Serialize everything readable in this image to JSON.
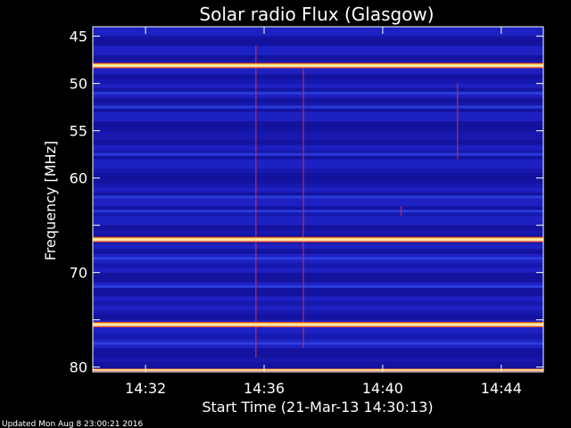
{
  "chart_data": {
    "type": "heatmap",
    "title": "Solar radio Flux (Glasgow)",
    "xlabel": "Start Time (21-Mar-13 14:30:13)",
    "ylabel": "Frequency [MHz]",
    "x_ticks": [
      "14:32",
      "14:36",
      "14:40",
      "14:44"
    ],
    "x_tick_minutes": [
      1.78,
      5.78,
      9.78,
      13.78
    ],
    "xlim_minutes": [
      0,
      15.2
    ],
    "y_ticks": [
      45,
      50,
      55,
      60,
      65,
      70,
      75,
      80
    ],
    "y_tick_labels": [
      "45",
      "50",
      "55",
      "60",
      "",
      "70",
      "",
      "80"
    ],
    "ylim": [
      44,
      80.5
    ],
    "y_inverted": true,
    "bright_bands_mhz": [
      48.1,
      66.5,
      75.5,
      80.3
    ],
    "weak_bands_mhz": [
      51.0,
      52.5,
      57.5,
      62.0,
      63.5,
      68.5,
      71.5,
      77.5
    ],
    "bursts": [
      {
        "t": 5.5,
        "f_start": 46,
        "f_end": 79
      },
      {
        "t": 7.1,
        "f_start": 48,
        "f_end": 78
      },
      {
        "t": 10.4,
        "f_start": 63,
        "f_end": 64
      },
      {
        "t": 12.3,
        "f_start": 50,
        "f_end": 58
      }
    ],
    "colors": {
      "background": "#000000",
      "base": "#1a1ab8",
      "band": "#ffe070",
      "band_edge": "#e02010"
    }
  },
  "footer": "Updated Mon Aug  8 23:00:21 2016"
}
